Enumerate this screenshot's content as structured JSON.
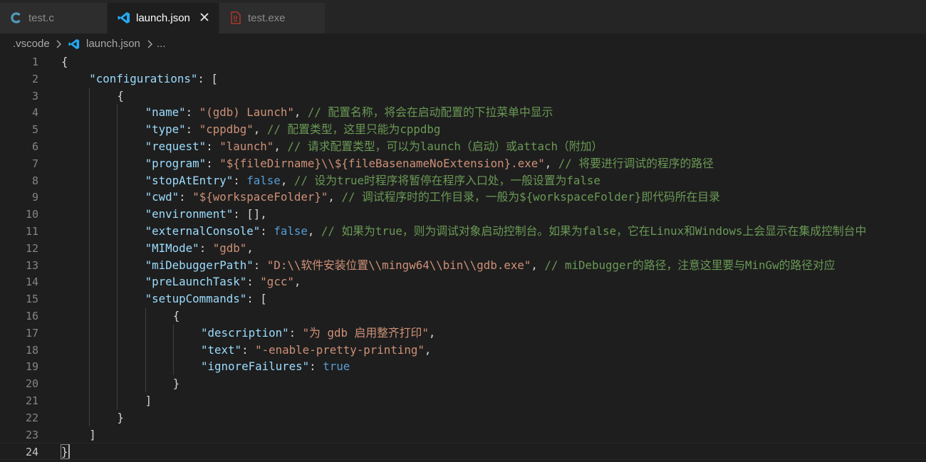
{
  "tabs": [
    {
      "label": "test.c",
      "icon": "c-language-icon",
      "active": false
    },
    {
      "label": "launch.json",
      "icon": "vscode-icon",
      "active": true
    },
    {
      "label": "test.exe",
      "icon": "binary-file-icon",
      "active": false
    }
  ],
  "breadcrumb": {
    "folder": ".vscode",
    "file": "launch.json",
    "more": "..."
  },
  "current_line": 24,
  "colors": {
    "background": "#1e1e1e",
    "tabbar": "#252526",
    "key": "#9cdcfe",
    "string": "#ce9178",
    "comment": "#6a9955",
    "keyword": "#569cd6",
    "punctuation": "#d4d4d4",
    "line_number": "#858585"
  },
  "code": [
    {
      "indent": 0,
      "tokens": [
        {
          "t": "{",
          "c": "p"
        }
      ]
    },
    {
      "indent": 1,
      "tokens": [
        {
          "t": "\"configurations\"",
          "c": "k"
        },
        {
          "t": ": [",
          "c": "p"
        }
      ]
    },
    {
      "indent": 2,
      "tokens": [
        {
          "t": "{",
          "c": "p"
        }
      ]
    },
    {
      "indent": 3,
      "tokens": [
        {
          "t": "\"name\"",
          "c": "k"
        },
        {
          "t": ": ",
          "c": "p"
        },
        {
          "t": "\"(gdb) Launch\"",
          "c": "s"
        },
        {
          "t": ", ",
          "c": "p"
        },
        {
          "t": "// 配置名称，将会在启动配置的下拉菜单中显示",
          "c": "c"
        }
      ]
    },
    {
      "indent": 3,
      "tokens": [
        {
          "t": "\"type\"",
          "c": "k"
        },
        {
          "t": ": ",
          "c": "p"
        },
        {
          "t": "\"cppdbg\"",
          "c": "s"
        },
        {
          "t": ", ",
          "c": "p"
        },
        {
          "t": "// 配置类型，这里只能为cppdbg",
          "c": "c"
        }
      ]
    },
    {
      "indent": 3,
      "tokens": [
        {
          "t": "\"request\"",
          "c": "k"
        },
        {
          "t": ": ",
          "c": "p"
        },
        {
          "t": "\"launch\"",
          "c": "s"
        },
        {
          "t": ", ",
          "c": "p"
        },
        {
          "t": "// 请求配置类型，可以为launch（启动）或attach（附加）",
          "c": "c"
        }
      ]
    },
    {
      "indent": 3,
      "tokens": [
        {
          "t": "\"program\"",
          "c": "k"
        },
        {
          "t": ": ",
          "c": "p"
        },
        {
          "t": "\"${fileDirname}\\\\${fileBasenameNoExtension}.exe\"",
          "c": "s"
        },
        {
          "t": ", ",
          "c": "p"
        },
        {
          "t": "// 将要进行调试的程序的路径",
          "c": "c"
        }
      ]
    },
    {
      "indent": 3,
      "tokens": [
        {
          "t": "\"stopAtEntry\"",
          "c": "k"
        },
        {
          "t": ": ",
          "c": "p"
        },
        {
          "t": "false",
          "c": "b"
        },
        {
          "t": ", ",
          "c": "p"
        },
        {
          "t": "// 设为true时程序将暂停在程序入口处，一般设置为false",
          "c": "c"
        }
      ]
    },
    {
      "indent": 3,
      "tokens": [
        {
          "t": "\"cwd\"",
          "c": "k"
        },
        {
          "t": ": ",
          "c": "p"
        },
        {
          "t": "\"${workspaceFolder}\"",
          "c": "s"
        },
        {
          "t": ", ",
          "c": "p"
        },
        {
          "t": "// 调试程序时的工作目录，一般为${workspaceFolder}即代码所在目录",
          "c": "c"
        }
      ]
    },
    {
      "indent": 3,
      "tokens": [
        {
          "t": "\"environment\"",
          "c": "k"
        },
        {
          "t": ": [],",
          "c": "p"
        }
      ]
    },
    {
      "indent": 3,
      "tokens": [
        {
          "t": "\"externalConsole\"",
          "c": "k"
        },
        {
          "t": ": ",
          "c": "p"
        },
        {
          "t": "false",
          "c": "b"
        },
        {
          "t": ", ",
          "c": "p"
        },
        {
          "t": "// 如果为true，则为调试对象启动控制台。如果为false，它在Linux和Windows上会显示在集成控制台中",
          "c": "c"
        }
      ]
    },
    {
      "indent": 3,
      "tokens": [
        {
          "t": "\"MIMode\"",
          "c": "k"
        },
        {
          "t": ": ",
          "c": "p"
        },
        {
          "t": "\"gdb\"",
          "c": "s"
        },
        {
          "t": ",",
          "c": "p"
        }
      ]
    },
    {
      "indent": 3,
      "tokens": [
        {
          "t": "\"miDebuggerPath\"",
          "c": "k"
        },
        {
          "t": ": ",
          "c": "p"
        },
        {
          "t": "\"D:\\\\软件安装位置\\\\mingw64\\\\bin\\\\gdb.exe\"",
          "c": "s"
        },
        {
          "t": ", ",
          "c": "p"
        },
        {
          "t": "// miDebugger的路径，注意这里要与MinGw的路径对应",
          "c": "c"
        }
      ]
    },
    {
      "indent": 3,
      "tokens": [
        {
          "t": "\"preLaunchTask\"",
          "c": "k"
        },
        {
          "t": ": ",
          "c": "p"
        },
        {
          "t": "\"gcc\"",
          "c": "s"
        },
        {
          "t": ",",
          "c": "p"
        }
      ]
    },
    {
      "indent": 3,
      "tokens": [
        {
          "t": "\"setupCommands\"",
          "c": "k"
        },
        {
          "t": ": [",
          "c": "p"
        }
      ]
    },
    {
      "indent": 4,
      "tokens": [
        {
          "t": "{",
          "c": "p"
        }
      ]
    },
    {
      "indent": 5,
      "tokens": [
        {
          "t": "\"description\"",
          "c": "k"
        },
        {
          "t": ": ",
          "c": "p"
        },
        {
          "t": "\"为 gdb 启用整齐打印\"",
          "c": "s"
        },
        {
          "t": ",",
          "c": "p"
        }
      ]
    },
    {
      "indent": 5,
      "tokens": [
        {
          "t": "\"text\"",
          "c": "k"
        },
        {
          "t": ": ",
          "c": "p"
        },
        {
          "t": "\"-enable-pretty-printing\"",
          "c": "s"
        },
        {
          "t": ",",
          "c": "p"
        }
      ]
    },
    {
      "indent": 5,
      "tokens": [
        {
          "t": "\"ignoreFailures\"",
          "c": "k"
        },
        {
          "t": ": ",
          "c": "p"
        },
        {
          "t": "true",
          "c": "b"
        }
      ]
    },
    {
      "indent": 4,
      "tokens": [
        {
          "t": "}",
          "c": "p"
        }
      ]
    },
    {
      "indent": 3,
      "tokens": [
        {
          "t": "]",
          "c": "p"
        }
      ]
    },
    {
      "indent": 2,
      "tokens": [
        {
          "t": "}",
          "c": "p"
        }
      ]
    },
    {
      "indent": 1,
      "tokens": [
        {
          "t": "]",
          "c": "p"
        }
      ]
    },
    {
      "indent": 0,
      "tokens": [
        {
          "t": "}",
          "c": "p"
        }
      ]
    }
  ]
}
